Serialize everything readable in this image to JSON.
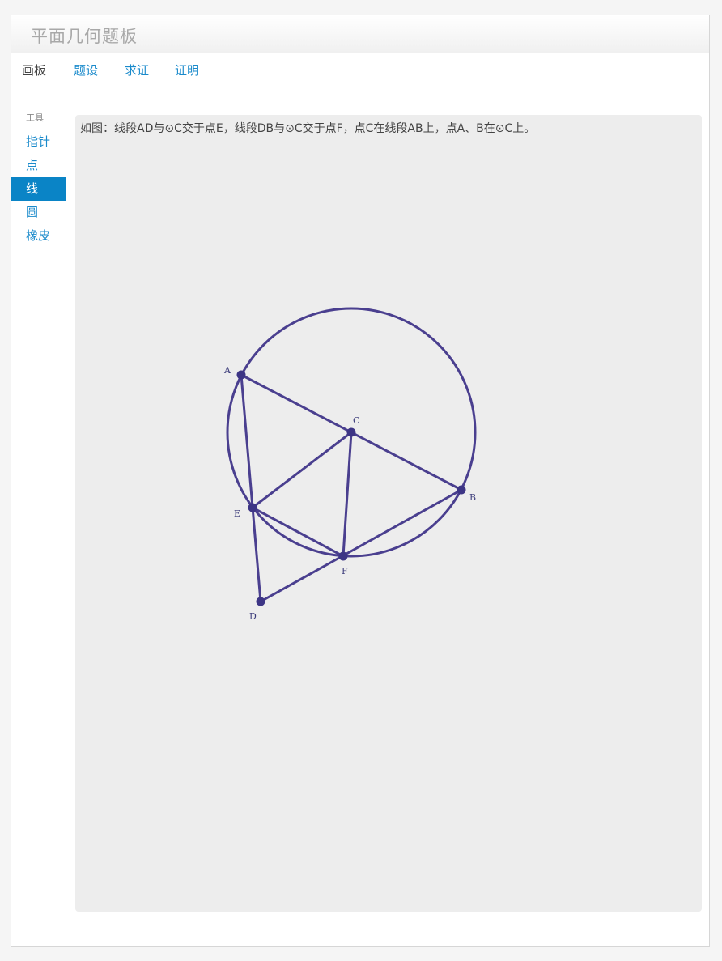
{
  "window": {
    "title": "平面几何题板"
  },
  "tabs": [
    {
      "label": "画板",
      "active": true
    },
    {
      "label": "题设",
      "active": false
    },
    {
      "label": "求证",
      "active": false
    },
    {
      "label": "证明",
      "active": false
    }
  ],
  "sidebar": {
    "header": "工具",
    "tools": [
      {
        "label": "指针",
        "active": false
      },
      {
        "label": "点",
        "active": false
      },
      {
        "label": "线",
        "active": true
      },
      {
        "label": "圆",
        "active": false
      },
      {
        "label": "橡皮",
        "active": false
      }
    ]
  },
  "board": {
    "problem_text": "如图：线段AD与⊙C交于点E，线段DB与⊙C交于点F，点C在线段AB上，点A、B在⊙C上。",
    "points": {
      "A": {
        "label": "A"
      },
      "B": {
        "label": "B"
      },
      "C": {
        "label": "C"
      },
      "D": {
        "label": "D"
      },
      "E": {
        "label": "E"
      },
      "F": {
        "label": "F"
      }
    },
    "segments": [
      "AB",
      "AD",
      "DB",
      "CE",
      "CF",
      "EF"
    ],
    "circle": {
      "center": "C",
      "through": "A"
    }
  },
  "colors": {
    "accent": "#1a8acb",
    "tool_active_bg": "#0a84c6",
    "board_bg": "#ededed",
    "figure_stroke": "#4a3f8f",
    "point_fill": "#3d3585"
  }
}
